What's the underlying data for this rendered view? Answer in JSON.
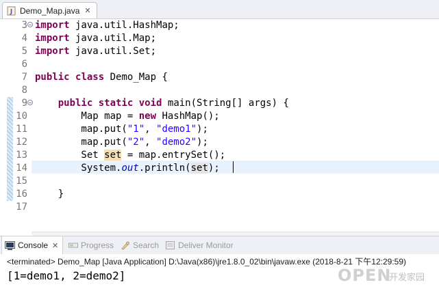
{
  "editor": {
    "tab_title": "Demo_Map.java",
    "tab_close": "✕",
    "lines": [
      {
        "num": "3",
        "fold": true,
        "hint": false,
        "html": "<span class=\"kw\">import</span> java.util.HashMap;"
      },
      {
        "num": "4",
        "fold": false,
        "hint": false,
        "html": "<span class=\"kw\">import</span> java.util.Map;"
      },
      {
        "num": "5",
        "fold": false,
        "hint": false,
        "html": "<span class=\"kw\">import</span> java.util.Set;"
      },
      {
        "num": "6",
        "fold": false,
        "hint": false,
        "html": ""
      },
      {
        "num": "7",
        "fold": false,
        "hint": false,
        "html": "<span class=\"kw\">public</span> <span class=\"kw\">class</span> Demo_Map {"
      },
      {
        "num": "8",
        "fold": false,
        "hint": false,
        "html": ""
      },
      {
        "num": "9",
        "fold": true,
        "hint": true,
        "html": "    <span class=\"kw\">public</span> <span class=\"kw\">static</span> <span class=\"kw\">void</span> main(String[] args) {"
      },
      {
        "num": "10",
        "fold": false,
        "hint": true,
        "html": "        Map map = <span class=\"kw\">new</span> HashMap();"
      },
      {
        "num": "11",
        "fold": false,
        "hint": true,
        "html": "        map.put(<span class=\"str\">\"1\"</span>, <span class=\"str\">\"demo1\"</span>);"
      },
      {
        "num": "12",
        "fold": false,
        "hint": true,
        "html": "        map.put(<span class=\"str\">\"2\"</span>, <span class=\"str\">\"demo2\"</span>);"
      },
      {
        "num": "13",
        "fold": false,
        "hint": true,
        "html": "        Set <span class=\"occ\">set</span> = map.entrySet();"
      },
      {
        "num": "14",
        "fold": false,
        "hint": true,
        "html": "        System.<span class=\"it\">out</span>.println(<span class=\"mark\">set</span>);"
      },
      {
        "num": "15",
        "fold": false,
        "hint": true,
        "html": ""
      },
      {
        "num": "16",
        "fold": false,
        "hint": true,
        "html": "    }"
      },
      {
        "num": "17",
        "fold": false,
        "hint": false,
        "html": ""
      }
    ]
  },
  "views": {
    "console": {
      "label": "Console",
      "close": "✕"
    },
    "progress": {
      "label": "Progress"
    },
    "search": {
      "label": "Search"
    },
    "deliver": {
      "label": "Deliver Monitor"
    }
  },
  "console": {
    "status": "<terminated> Demo_Map [Java Application] D:\\Java(x86)\\jre1.8.0_02\\bin\\javaw.exe (2018-8-21 下午12:29:59)",
    "output": "[1=demo1, 2=demo2]"
  },
  "watermark": {
    "main": "OPEN",
    "sub": "开发家园"
  },
  "colors": {
    "keyword": "#7f0055",
    "string": "#2a00ff",
    "field": "#0000c0",
    "current_line": "#e8f2fe"
  }
}
